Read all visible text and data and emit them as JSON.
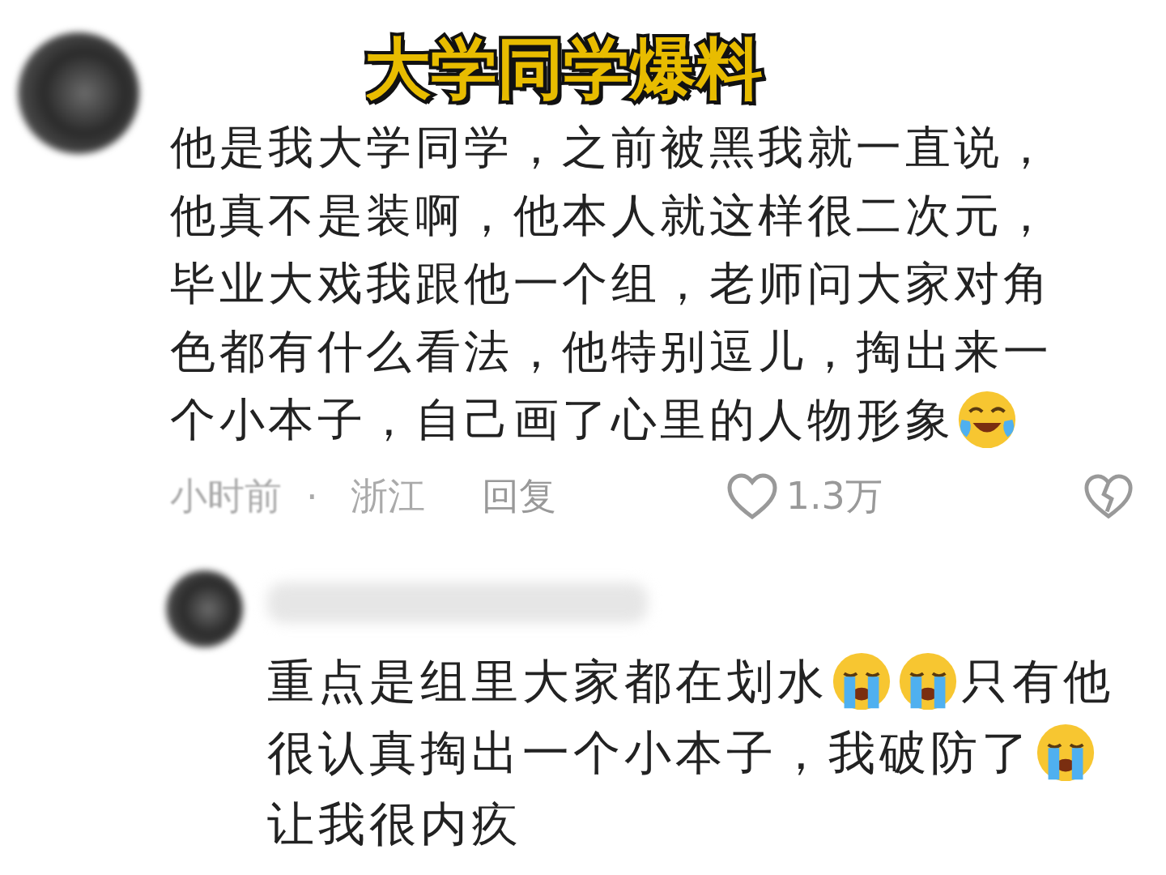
{
  "caption": "大学同学爆料",
  "comments": [
    {
      "lines": [
        {
          "segments": [
            {
              "kind": "text",
              "text": "他是我大学同学，之前被黑我就一直说，"
            }
          ]
        },
        {
          "segments": [
            {
              "kind": "text",
              "text": "他真不是装啊，他本人就这样很二次元，"
            }
          ]
        },
        {
          "segments": [
            {
              "kind": "text",
              "text": "毕业大戏我跟他一个组，老师问大家对角"
            }
          ]
        },
        {
          "segments": [
            {
              "kind": "text",
              "text": "色都有什么看法，他特别逗儿，掏出来一"
            }
          ]
        },
        {
          "segments": [
            {
              "kind": "text",
              "text": "个小本子，自己画了心里的人物形象"
            },
            {
              "kind": "laughing-emoji"
            }
          ]
        }
      ],
      "time": "小时前",
      "separator": "·",
      "location": "浙江",
      "reply": "回复",
      "likes": "1.3万"
    },
    {
      "lines": [
        {
          "segments": [
            {
              "kind": "text",
              "text": "重点是组里大家都在划水"
            },
            {
              "kind": "crying-emoji"
            },
            {
              "kind": "crying-emoji"
            },
            {
              "kind": "text",
              "text": "只有他"
            }
          ]
        },
        {
          "segments": [
            {
              "kind": "text",
              "text": "很认真掏出一个小本子，我破防了"
            },
            {
              "kind": "crying-emoji"
            }
          ]
        },
        {
          "segments": [
            {
              "kind": "text",
              "text": "让我很内疚"
            }
          ]
        }
      ]
    }
  ]
}
